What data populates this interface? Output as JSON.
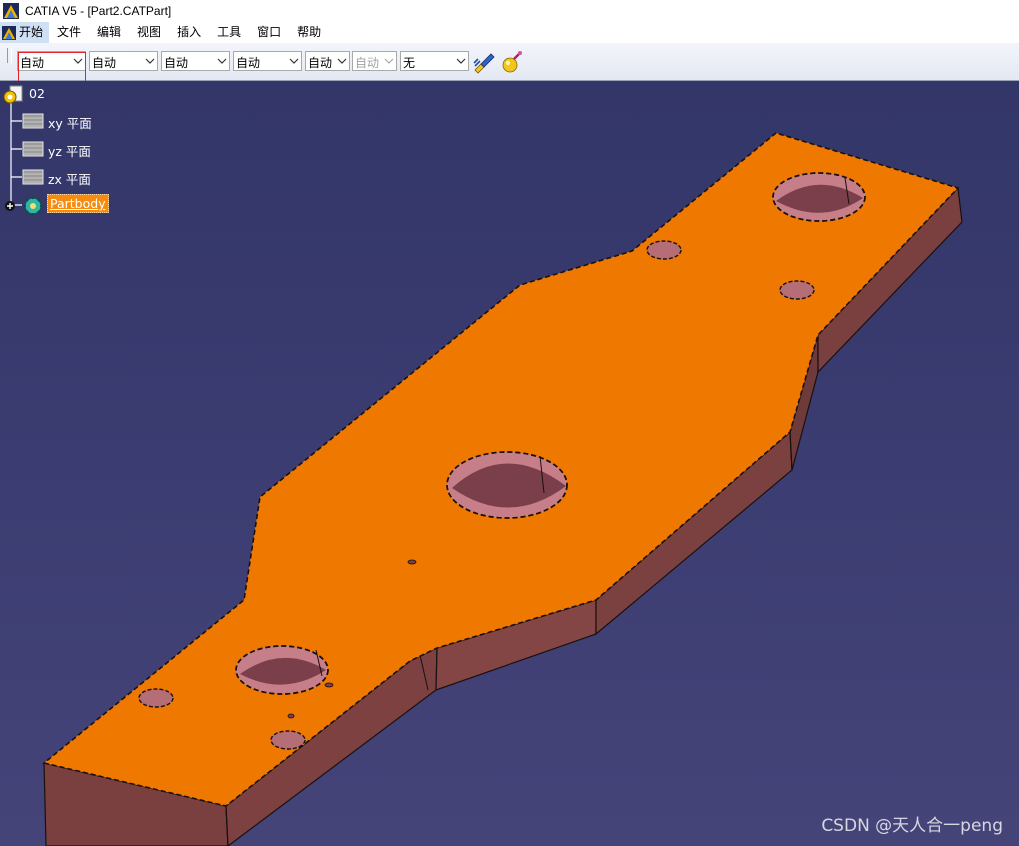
{
  "window": {
    "title": "CATIA V5 - [Part2.CATPart]"
  },
  "menu": [
    "开始",
    "文件",
    "编辑",
    "视图",
    "插入",
    "工具",
    "窗口",
    "帮助"
  ],
  "toolbar": {
    "combos": [
      {
        "value": "自动",
        "enabled": true
      },
      {
        "value": "自动",
        "enabled": true
      },
      {
        "value": "自动",
        "enabled": true
      },
      {
        "value": "自动",
        "enabled": true
      },
      {
        "value": "自动",
        "enabled": true
      },
      {
        "value": "自动",
        "enabled": false
      },
      {
        "value": "无",
        "enabled": true
      }
    ],
    "icons": [
      "painter-brush-icon",
      "apply-material-icon"
    ]
  },
  "tree": {
    "root": "02",
    "planes": [
      "xy 平面",
      "yz 平面",
      "zx 平面"
    ],
    "body": "Partbody"
  },
  "colors": {
    "viewport_top": "#333669",
    "viewport_bottom": "#454479",
    "part_face": "#ef7800",
    "part_side": "#7a3f3f",
    "selection_red": "#e0252c"
  },
  "watermark": "CSDN @天人合一peng"
}
